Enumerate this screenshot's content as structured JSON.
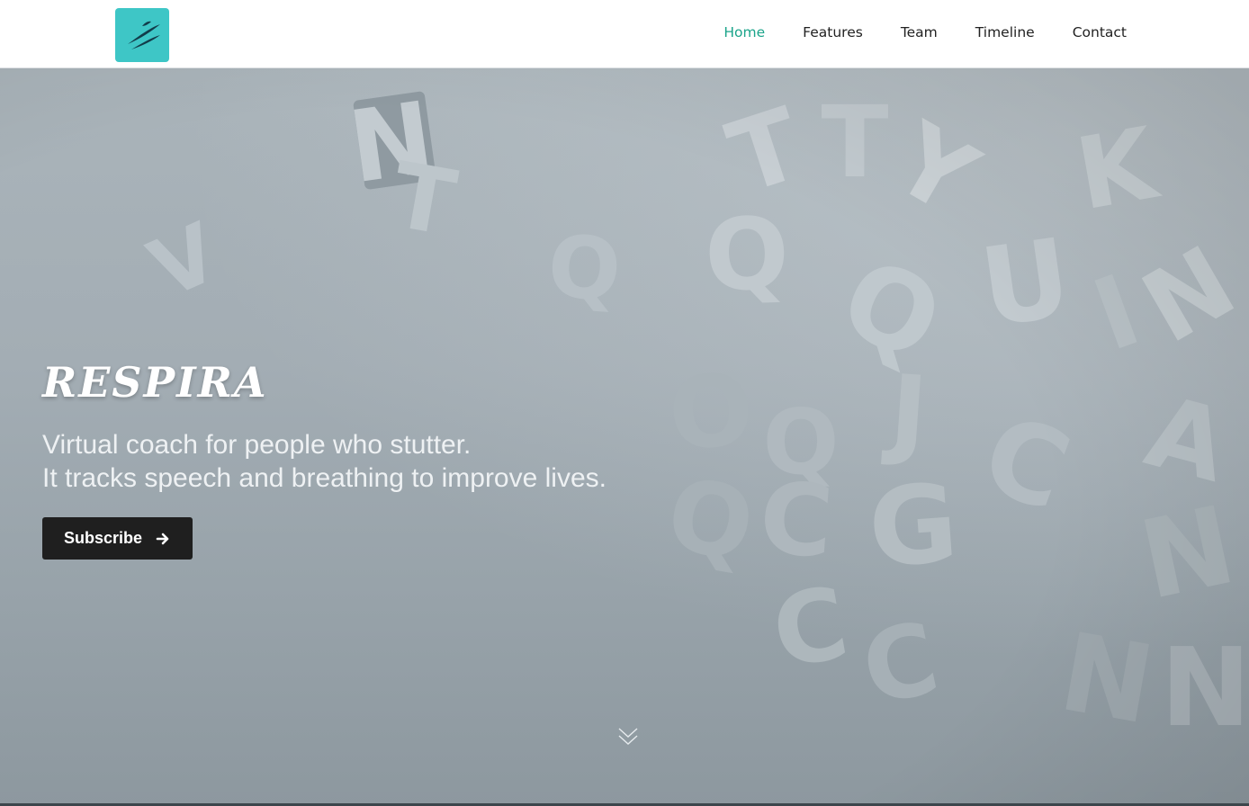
{
  "header": {
    "logo_icon": "respira-swoosh-logo",
    "logo_color": "#3ec6c6",
    "nav": [
      {
        "label": "Home",
        "active": true
      },
      {
        "label": "Features",
        "active": false
      },
      {
        "label": "Team",
        "active": false
      },
      {
        "label": "Timeline",
        "active": false
      },
      {
        "label": "Contact",
        "active": false
      }
    ],
    "active_color": "#1ba48a"
  },
  "hero": {
    "brand": "RESPIRA",
    "tagline_line1": "Virtual coach for people who stutter.",
    "tagline_line2": "It tracks speech and breathing to improve lives.",
    "subscribe_label": "Subscribe",
    "subscribe_icon": "arrow-right-icon",
    "scroll_icon": "chevron-down-icon",
    "background_image": "scattered-3d-letters",
    "button_color": "#1f1f1f"
  }
}
